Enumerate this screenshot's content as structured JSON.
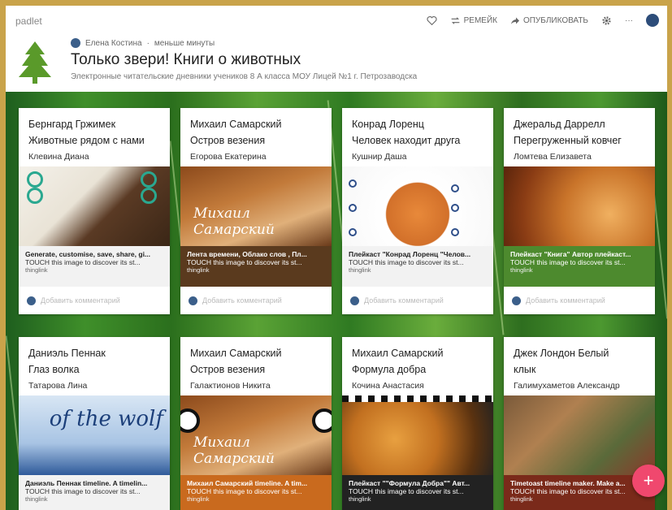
{
  "header": {
    "logo": "padlet",
    "actions": [
      {
        "icon": "heart-icon",
        "label": ""
      },
      {
        "icon": "remake-icon",
        "label": "РЕМЕЙК"
      },
      {
        "icon": "share-icon",
        "label": "ОПУБЛИКОВАТЬ"
      },
      {
        "icon": "gear-icon",
        "label": ""
      },
      {
        "icon": "more-icon",
        "label": "···"
      }
    ],
    "author": "Елена Костина",
    "time": "меньше минуты",
    "title": "Только звери! Книги о животных",
    "subtitle": "Электронные читательские дневники учеников 8 А класса МОУ Лицей №1 г. Петрозаводска"
  },
  "cards": [
    {
      "line1": "Бернгард Гржимек",
      "line2": "Животные рядом с нами",
      "author": "Клевина Диана",
      "cap1": "Generate, customise, save, share, gi...",
      "cap2": "TOUCH this image to discover its st...",
      "cap3": "thinglink",
      "comment": "Добавить комментарий"
    },
    {
      "line1": "Михаил Самарский",
      "line2": "Остров везения",
      "author": "Егорова Екатерина",
      "cap1": "Лента времени, Облако слов , Пл...",
      "cap2": "TOUCH this image to discover its st...",
      "cap3": "thinglink",
      "overlay": "Михаил Самарский",
      "comment": "Добавить комментарий"
    },
    {
      "line1": "Конрад Лоренц",
      "line2": "Человек находит друга",
      "author": "Кушнир Даша",
      "cap1": "Плейкаст \"Конрад Лоренц \"Челов...",
      "cap2": "TOUCH this image to discover its st...",
      "cap3": "thinglink",
      "comment": "Добавить комментарий"
    },
    {
      "line1": "Джеральд Даррелл",
      "line2": "Перегруженный ковчег",
      "author": "Ломтева Елизавета",
      "cap1": "Плейкаст \"Книга\" Автор плейкаст...",
      "cap2": "TOUCH this image to discover its st...",
      "cap3": "thinglink",
      "comment": "Добавить комментарий"
    },
    {
      "line1": "Даниэль Пеннак",
      "line2": "Глаз волка",
      "author": "Татарова Лина",
      "cap1": "Даниэль Пеннак timeline. A timelin...",
      "cap2": "TOUCH this image to discover its st...",
      "cap3": "thinglink",
      "overlay": "of the wolf"
    },
    {
      "line1": "Михаил Самарский",
      "line2": "Остров везения",
      "author": "Галактионов Никита",
      "cap1": "Михаил Самарский timeline. A tim...",
      "cap2": "TOUCH this image to discover its st...",
      "cap3": "thinglink",
      "overlay": "Михаил Самарский"
    },
    {
      "line1": "Михаил Самарский",
      "line2": "Формула добра",
      "author": "Кочина Анастасия",
      "cap1": "Плейкаст \"\"Формула Добра\"\" Авт...",
      "cap2": "TOUCH this image to discover its st...",
      "cap3": "thinglink"
    },
    {
      "line1": "Джек Лондон Белый",
      "line2": "клык",
      "author": "Галимухаметов Александр",
      "cap1": "Timetoast timeline maker. Make a...",
      "cap2": "TOUCH this image to discover its st...",
      "cap3": "thinglink"
    }
  ],
  "fab": "+",
  "colors": {
    "accent": "#f0486e",
    "frame": "#c9a34a"
  }
}
